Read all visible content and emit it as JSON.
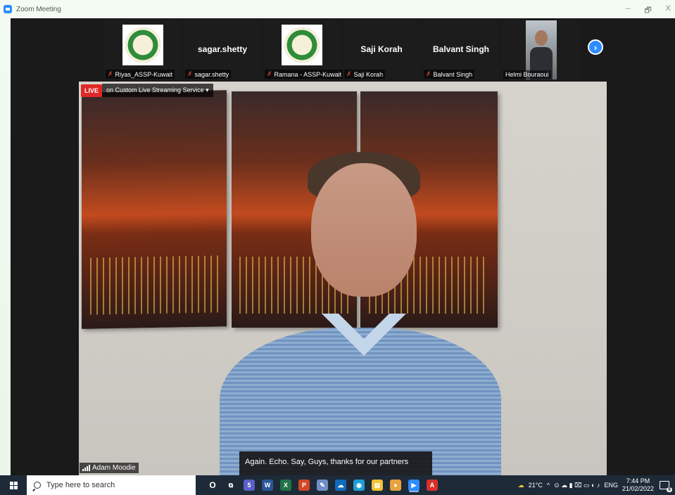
{
  "window": {
    "title": "Zoom Meeting",
    "controls": [
      "–",
      "🗗",
      "X"
    ]
  },
  "participants": [
    {
      "kind": "logo",
      "label": "Riyas_ASSP-Kuwait",
      "muted": true
    },
    {
      "kind": "name",
      "display": "sagar.shetty",
      "label": "sagar.shetty",
      "muted": true
    },
    {
      "kind": "logo",
      "label": "Ramana - ASSP-Kuwait",
      "muted": true
    },
    {
      "kind": "name",
      "display": "Saji Korah",
      "label": "Saji Korah",
      "muted": true
    },
    {
      "kind": "name",
      "display": "Balvant Singh",
      "label": "Balvant Singh",
      "muted": true
    },
    {
      "kind": "video",
      "label": "Helmi Bouraoui",
      "muted": false
    }
  ],
  "next_icon": "chevron-right-icon",
  "live": {
    "badge": "LIVE",
    "text": "on Custom Live Streaming Service",
    "dropdown_icon": "▾"
  },
  "speaker": {
    "name": "Adam Moodie"
  },
  "caption": {
    "text": "Again. Echo. Say, Guys, thanks for our partners"
  },
  "taskbar": {
    "search_placeholder": "Type here to search",
    "cortana_label": "O",
    "apps": [
      {
        "name": "task-view-icon",
        "glyph": "⧉",
        "color": "#1e2a38"
      },
      {
        "name": "teams-icon",
        "glyph": "5",
        "color": "#5b5fc7"
      },
      {
        "name": "word-icon",
        "glyph": "W",
        "color": "#2b579a"
      },
      {
        "name": "excel-icon",
        "glyph": "X",
        "color": "#217346"
      },
      {
        "name": "powerpoint-icon",
        "glyph": "P",
        "color": "#d24726"
      },
      {
        "name": "paint-icon",
        "glyph": "✎",
        "color": "#6f8fc9"
      },
      {
        "name": "onedrive-icon",
        "glyph": "☁",
        "color": "#0f6cbd"
      },
      {
        "name": "photos-icon",
        "glyph": "◉",
        "color": "#1f9fd6"
      },
      {
        "name": "file-explorer-icon",
        "glyph": "▤",
        "color": "#f2c230"
      },
      {
        "name": "chrome-icon",
        "glyph": "●",
        "color": "#e8a33d"
      },
      {
        "name": "zoom-icon",
        "glyph": "▶",
        "color": "#2d8cff"
      },
      {
        "name": "acrobat-icon",
        "glyph": "A",
        "color": "#d9302a"
      }
    ],
    "weather": "21°C",
    "language": "ENG",
    "time": "7:44 PM",
    "date": "21/02/2022",
    "notifications": "8"
  }
}
